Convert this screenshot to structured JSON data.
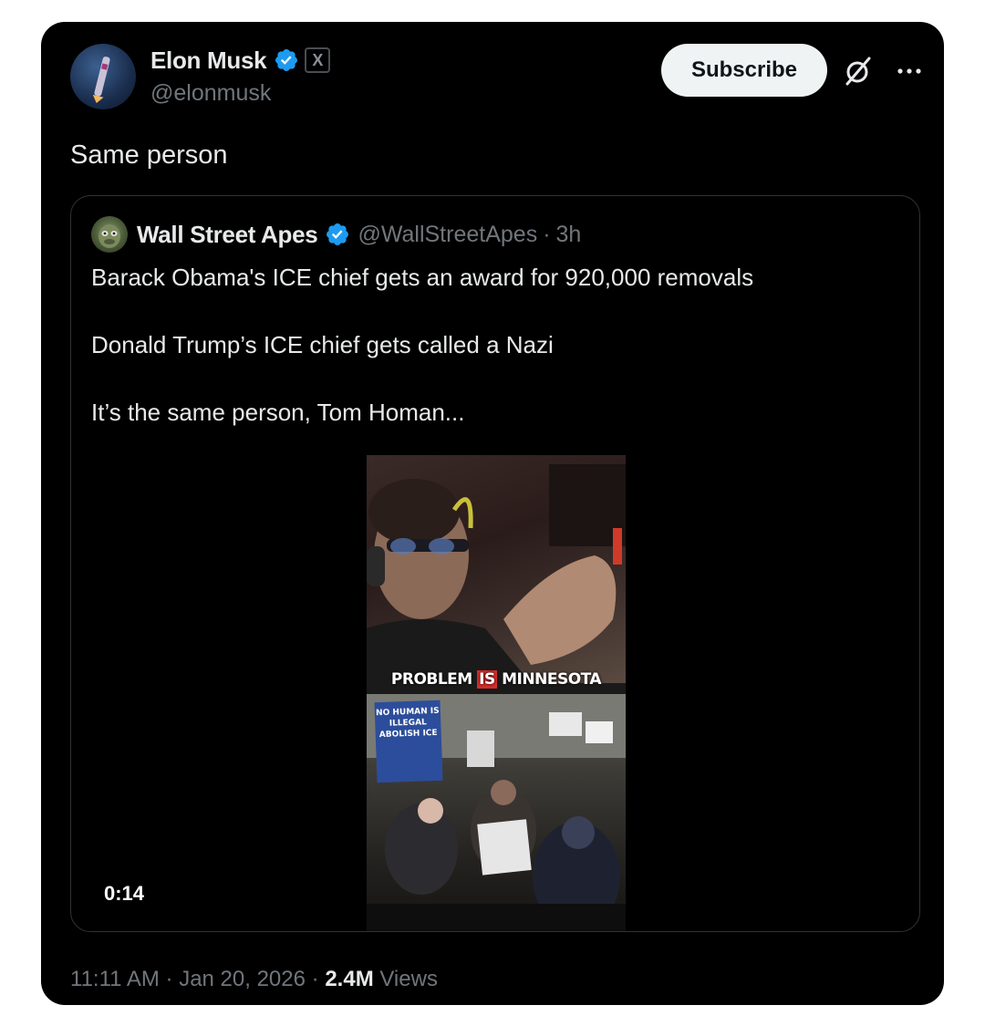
{
  "author": {
    "name": "Elon Musk",
    "handle": "@elonmusk",
    "badge_label": "X"
  },
  "actions": {
    "subscribe_label": "Subscribe",
    "grok_icon": "grok-icon",
    "more_icon": "more-icon"
  },
  "tweet": {
    "text": "Same person"
  },
  "quote": {
    "name": "Wall Street Apes",
    "handle": "@WallStreetApes",
    "separator": "·",
    "time": "3h",
    "lines": [
      "Barack Obama's ICE chief gets an award for 920,000 removals",
      "Donald Trump’s ICE chief gets called a Nazi",
      "It’s the same person, Tom Homan..."
    ],
    "video": {
      "caption_pre": "PROBLEM",
      "caption_mid": "IS",
      "caption_post": "MINNESOTA",
      "sign_text": "NO HUMAN IS ILLEGAL ABOLISH ICE",
      "duration": "0:14"
    }
  },
  "meta": {
    "time": "11:11 AM",
    "date": "Jan 20, 2026",
    "views_count": "2.4M",
    "views_label": "Views",
    "separator": "·"
  },
  "colors": {
    "background": "#000000",
    "text": "#e7e9ea",
    "muted": "#71767b",
    "verified": "#1d9bf0",
    "border": "#2f3336"
  }
}
